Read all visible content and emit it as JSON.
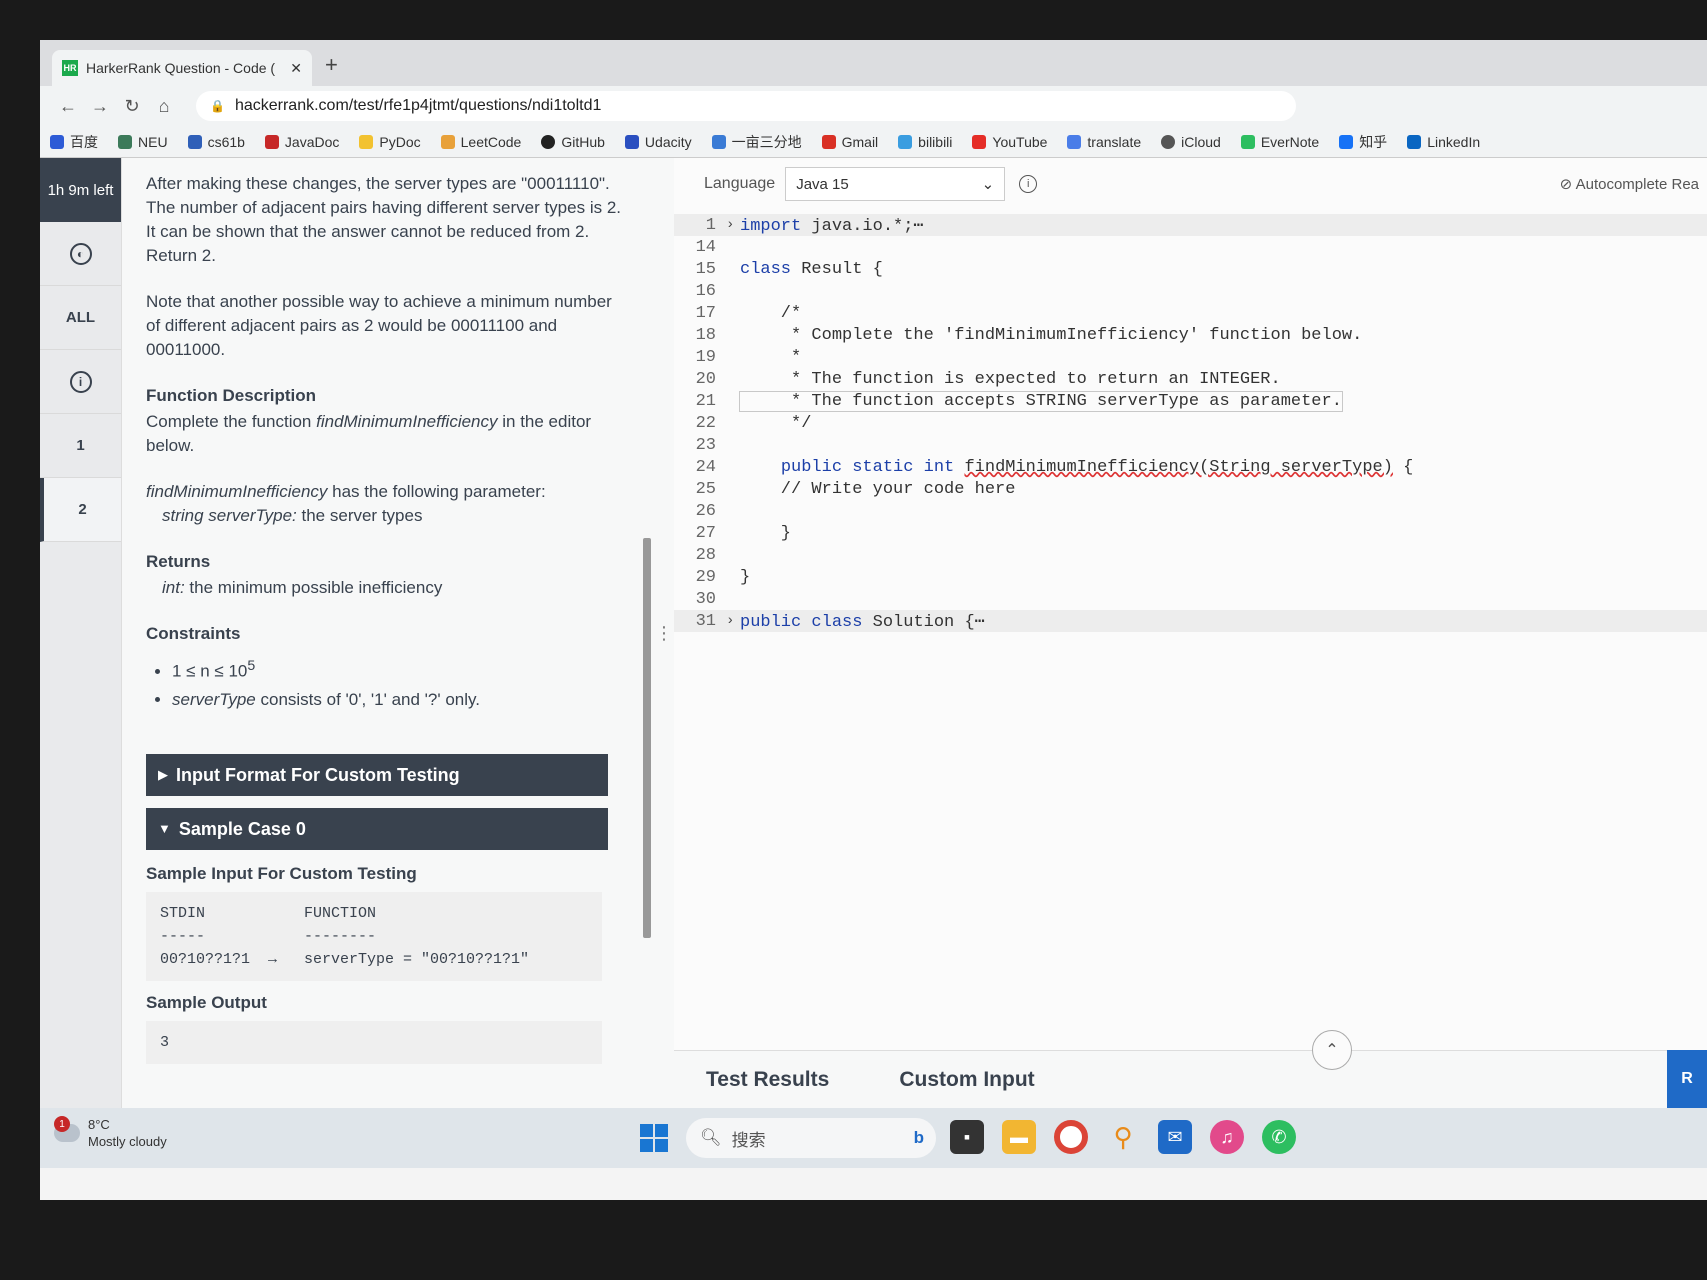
{
  "browser": {
    "tab_title": "HarkerRank Question - Code (",
    "new_tab": "+",
    "url": "hackerrank.com/test/rfe1p4jtmt/questions/ndi1toltd1",
    "bookmarks": [
      "百度",
      "NEU",
      "cs61b",
      "JavaDoc",
      "PyDoc",
      "LeetCode",
      "GitHub",
      "Udacity",
      "一亩三分地",
      "Gmail",
      "bilibili",
      "YouTube",
      "translate",
      "iCloud",
      "EverNote",
      "知乎",
      "LinkedIn"
    ]
  },
  "sidebar": {
    "timer": "1h 9m left",
    "all": "ALL",
    "q1": "1",
    "q2": "2"
  },
  "problem": {
    "para1": "After making these changes, the server types are \"00011110\". The number of adjacent pairs having different server types is 2. It can be shown that the answer cannot be reduced from 2. Return 2.",
    "para2": "Note that another possible way to achieve a minimum number of different adjacent pairs as 2 would be 00011100 and 00011000.",
    "func_desc_title": "Function Description",
    "func_desc_pre": "Complete the function ",
    "func_name": "findMinimumInefficiency",
    "func_desc_post": " in the editor below.",
    "param_intro_post": " has the following parameter:",
    "param_name": "string serverType:",
    "param_desc": " the server types",
    "returns_title": "Returns",
    "returns_type": "int:",
    "returns_desc": " the minimum possible inefficiency",
    "constraints_title": "Constraints",
    "constraint1": "1 ≤ n ≤ 10",
    "constraint1_exp": "5",
    "constraint2_name": "serverType",
    "constraint2_rest": " consists of '0', '1' and '?' only.",
    "input_format": "Input Format For Custom Testing",
    "sample_case": "Sample Case 0",
    "sample_input_title": "Sample Input For Custom Testing",
    "sample_input": "STDIN           FUNCTION\n-----           --------\n00?10??1?1  →   serverType = \"00?10??1?1\"",
    "sample_output_title": "Sample Output",
    "sample_output": "3"
  },
  "editor": {
    "language_label": "Language",
    "language": "Java 15",
    "autocomplete": "Autocomplete Rea",
    "tabs": [
      "Test Results",
      "Custom Input"
    ],
    "run_label": "R",
    "lines": [
      {
        "n": "1",
        "fold": "›",
        "text": "import java.io.*;⋯",
        "folded": true
      },
      {
        "n": "14",
        "text": ""
      },
      {
        "n": "15",
        "text": "class Result {"
      },
      {
        "n": "16",
        "text": ""
      },
      {
        "n": "17",
        "text": "    /*"
      },
      {
        "n": "18",
        "text": "     * Complete the 'findMinimumInefficiency' function below."
      },
      {
        "n": "19",
        "text": "     *"
      },
      {
        "n": "20",
        "text": "     * The function is expected to return an INTEGER."
      },
      {
        "n": "21",
        "text": "     * The function accepts STRING serverType as parameter.",
        "current": true
      },
      {
        "n": "22",
        "text": "     */"
      },
      {
        "n": "23",
        "text": ""
      },
      {
        "n": "24",
        "text": "    public static int findMinimumInefficiency(String serverType) {"
      },
      {
        "n": "25",
        "text": "    // Write your code here"
      },
      {
        "n": "26",
        "text": ""
      },
      {
        "n": "27",
        "text": "    }"
      },
      {
        "n": "28",
        "text": ""
      },
      {
        "n": "29",
        "text": "}"
      },
      {
        "n": "30",
        "text": ""
      },
      {
        "n": "31",
        "fold": "›",
        "text": "public class Solution {⋯",
        "folded": true
      }
    ]
  },
  "taskbar": {
    "badge": "1",
    "temp": "8°C",
    "weather": "Mostly cloudy",
    "search": "搜索"
  },
  "colors": {
    "header_dark": "#39424e",
    "keyword": "#1c3fa8",
    "run_button": "#1f6ac7"
  }
}
